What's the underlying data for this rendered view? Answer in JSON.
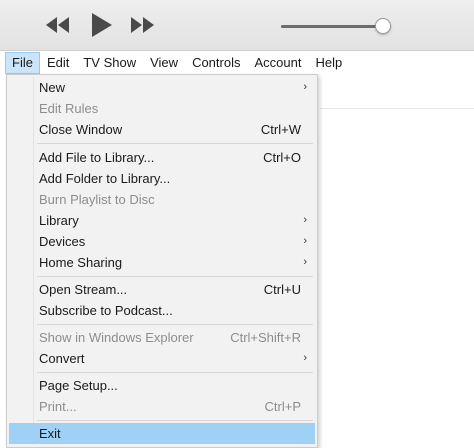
{
  "menubar": {
    "items": [
      {
        "label": "File"
      },
      {
        "label": "Edit"
      },
      {
        "label": "TV Show"
      },
      {
        "label": "View"
      },
      {
        "label": "Controls"
      },
      {
        "label": "Account"
      },
      {
        "label": "Help"
      }
    ]
  },
  "player": {
    "volume_level": 0.95,
    "prev_icon": "rewind-icon",
    "play_icon": "play-icon",
    "next_icon": "fast-forward-icon"
  },
  "file_menu": {
    "new": {
      "label": "New",
      "arrow": "›"
    },
    "edit_rules": {
      "label": "Edit Rules"
    },
    "close_window": {
      "label": "Close Window",
      "shortcut": "Ctrl+W"
    },
    "add_file": {
      "label": "Add File to Library...",
      "shortcut": "Ctrl+O"
    },
    "add_folder": {
      "label": "Add Folder to Library..."
    },
    "burn_playlist": {
      "label": "Burn Playlist to Disc"
    },
    "library": {
      "label": "Library",
      "arrow": "›"
    },
    "devices": {
      "label": "Devices",
      "arrow": "›"
    },
    "home_sharing": {
      "label": "Home Sharing",
      "arrow": "›"
    },
    "open_stream": {
      "label": "Open Stream...",
      "shortcut": "Ctrl+U"
    },
    "subscribe_podcast": {
      "label": "Subscribe to Podcast..."
    },
    "show_explorer": {
      "label": "Show in Windows Explorer",
      "shortcut": "Ctrl+Shift+R"
    },
    "convert": {
      "label": "Convert",
      "arrow": "›"
    },
    "page_setup": {
      "label": "Page Setup..."
    },
    "print": {
      "label": "Print...",
      "shortcut": "Ctrl+P"
    },
    "exit": {
      "label": "Exit"
    }
  },
  "colors": {
    "highlight": "#9fd0f5",
    "menu_active": "#cce4f7",
    "disabled_text": "#8d8d8d"
  }
}
